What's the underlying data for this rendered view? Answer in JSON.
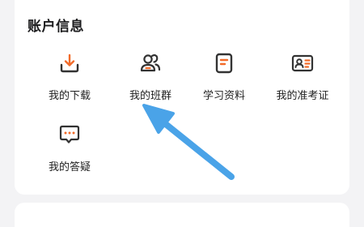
{
  "section": {
    "title": "账户信息"
  },
  "items": [
    {
      "label": "我的下载",
      "icon": "download-icon"
    },
    {
      "label": "我的班群",
      "icon": "group-icon"
    },
    {
      "label": "学习资料",
      "icon": "document-icon"
    },
    {
      "label": "我的准考证",
      "icon": "id-card-icon"
    },
    {
      "label": "我的答疑",
      "icon": "chat-bubble-icon"
    }
  ],
  "colors": {
    "accent": "#f26b2a",
    "icon_stroke": "#333333",
    "arrow": "#4aa3e8"
  }
}
